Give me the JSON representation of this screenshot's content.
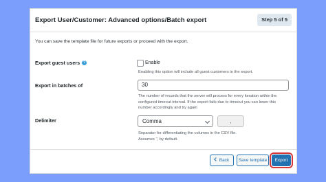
{
  "header": {
    "title": "Export User/Customer: Advanced options/Batch export",
    "step": "Step 5 of 5"
  },
  "intro": "You can save the template file for future exports or proceed with the export.",
  "guest": {
    "label": "Export guest users",
    "checkbox_label": "Enable",
    "checked": false,
    "help": "Enabling this option will include all guest customers in the export."
  },
  "batch": {
    "label": "Export in batches of",
    "value": "30",
    "help_lines": [
      "The number of records that the server will process for every iteration within the",
      "configured timeout interval. If the export fails due to timeout you can lower this",
      "number accordingly and try again"
    ]
  },
  "delimiter": {
    "label": "Delimiter",
    "selected": "Comma",
    "value": ",",
    "help_lines": [
      "Separator for differentiating the columns in the CSV file.",
      "Assumes ',' by default."
    ]
  },
  "footer": {
    "back_label": "Back",
    "save_label": "Save template",
    "export_label": "Export"
  },
  "icons": {
    "help": "help-icon",
    "back": "back-arrow-icon",
    "dropdown": "chevron-down-icon"
  },
  "colors": {
    "background": "#7b9dfb",
    "primary": "#2271b1",
    "highlight": "#d63638"
  }
}
